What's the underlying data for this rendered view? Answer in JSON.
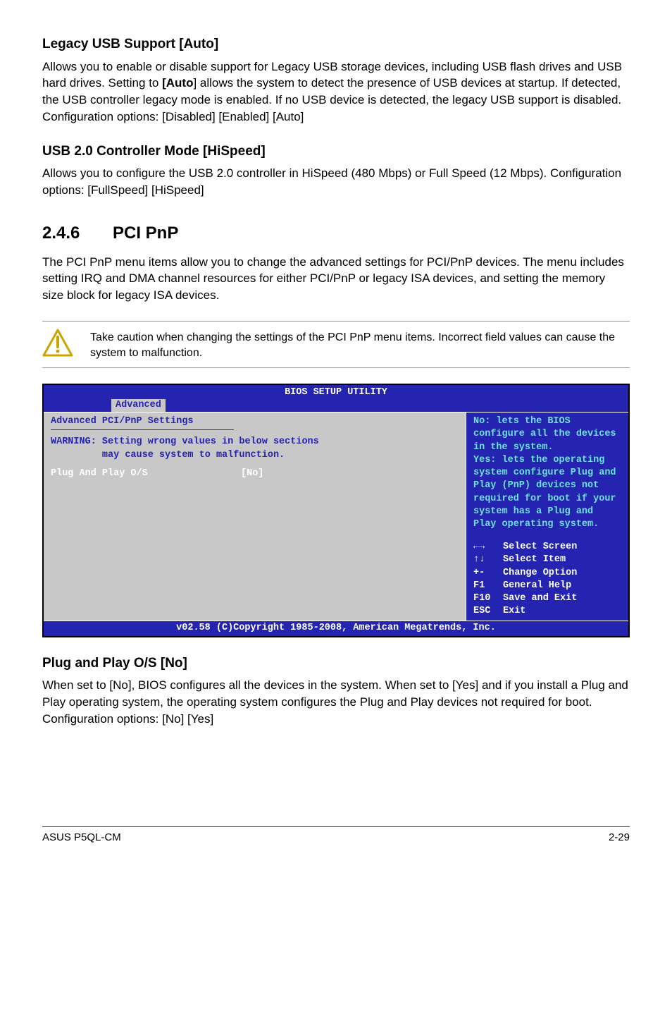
{
  "s1": {
    "h": "Legacy USB Support [Auto]",
    "p": "Allows you to enable or disable support for Legacy USB storage devices, including USB flash drives and USB hard drives. Setting to [Auto] allows the system to detect the presence of USB devices at startup. If detected, the USB controller legacy mode is enabled. If no USB device is detected, the legacy USB support is disabled. Configuration options: [Disabled] [Enabled] [Auto]"
  },
  "s2": {
    "h": "USB 2.0 Controller Mode [HiSpeed]",
    "p": "Allows you to configure the USB 2.0 controller in HiSpeed (480 Mbps) or Full Speed (12 Mbps). Configuration options: [FullSpeed] [HiSpeed]"
  },
  "section": {
    "num": "2.4.6",
    "title": "PCI PnP",
    "p": "The PCI PnP menu items allow you to change the advanced settings for PCI/PnP devices. The menu includes setting IRQ and DMA channel resources for either PCI/PnP or legacy ISA devices, and setting the memory size block for legacy ISA devices."
  },
  "caution": "Take caution when changing the settings of the PCI PnP menu items. Incorrect field values can cause the system to malfunction.",
  "bios": {
    "title": "BIOS SETUP UTILITY",
    "tab": "Advanced",
    "heading": "Advanced PCI/PnP Settings",
    "warning_l1": "WARNING: Setting wrong values in below sections",
    "warning_l2": "         may cause system to malfunction.",
    "row_label": "Plug And Play O/S",
    "row_value": "[No]",
    "help": "No: lets the BIOS configure all the devices in the system.\nYes: lets the operating system configure Plug and Play (PnP) devices not required for boot if your system has a Plug and Play operating system.",
    "keys": [
      {
        "sym": "←→",
        "txt": "Select Screen"
      },
      {
        "sym": "↑↓",
        "txt": "Select Item"
      },
      {
        "sym": "+-",
        "txt": "Change Option"
      },
      {
        "sym": "F1",
        "txt": "General Help"
      },
      {
        "sym": "F10",
        "txt": "Save and Exit"
      },
      {
        "sym": "ESC",
        "txt": "Exit"
      }
    ],
    "footer": "v02.58 (C)Copyright 1985-2008, American Megatrends, Inc."
  },
  "s3": {
    "h": "Plug and Play O/S [No]",
    "p": "When set to [No], BIOS configures all the devices in the system. When set to [Yes] and if you install a Plug and Play operating system, the operating system configures the Plug and Play devices not required for boot. Configuration options: [No] [Yes]"
  },
  "footer": {
    "left": "ASUS P5QL-CM",
    "right": "2-29"
  }
}
